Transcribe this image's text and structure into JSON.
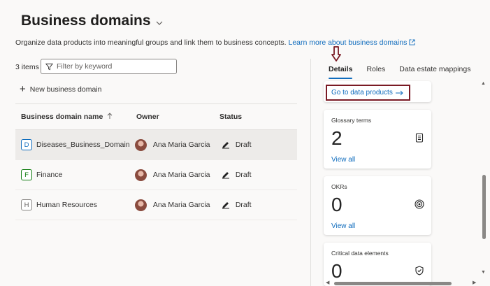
{
  "header": {
    "title": "Business domains"
  },
  "description": {
    "text": "Organize data products into meaningful groups and link them to business concepts. ",
    "link": "Learn more about business domains"
  },
  "toolbar": {
    "items_count": "3 items",
    "filter_placeholder": "Filter by keyword",
    "new_button": "New business domain"
  },
  "table": {
    "columns": {
      "name": "Business domain name",
      "owner": "Owner",
      "status": "Status"
    },
    "rows": [
      {
        "letter": "D",
        "name": "Diseases_Business_Domain",
        "owner": "Ana Maria Garcia",
        "status": "Draft",
        "badge_color": "#0f6cbd"
      },
      {
        "letter": "F",
        "name": "Finance",
        "owner": "Ana Maria Garcia",
        "status": "Draft",
        "badge_color": "#107c10"
      },
      {
        "letter": "H",
        "name": "Human Resources",
        "owner": "Ana Maria Garcia",
        "status": "Draft",
        "badge_color": "#605e5c"
      }
    ]
  },
  "panel": {
    "tabs": [
      "Details",
      "Roles",
      "Data estate mappings"
    ],
    "go_link": "Go to data products",
    "cards": [
      {
        "title": "Glossary terms",
        "value": "2",
        "view": "View all",
        "icon": "document-icon"
      },
      {
        "title": "OKRs",
        "value": "0",
        "view": "View all",
        "icon": "target-icon"
      },
      {
        "title": "Critical data elements",
        "value": "0",
        "view": "",
        "icon": "shield-icon"
      }
    ]
  },
  "colors": {
    "accent": "#0f6cbd",
    "highlight_border": "#7a1a24"
  }
}
